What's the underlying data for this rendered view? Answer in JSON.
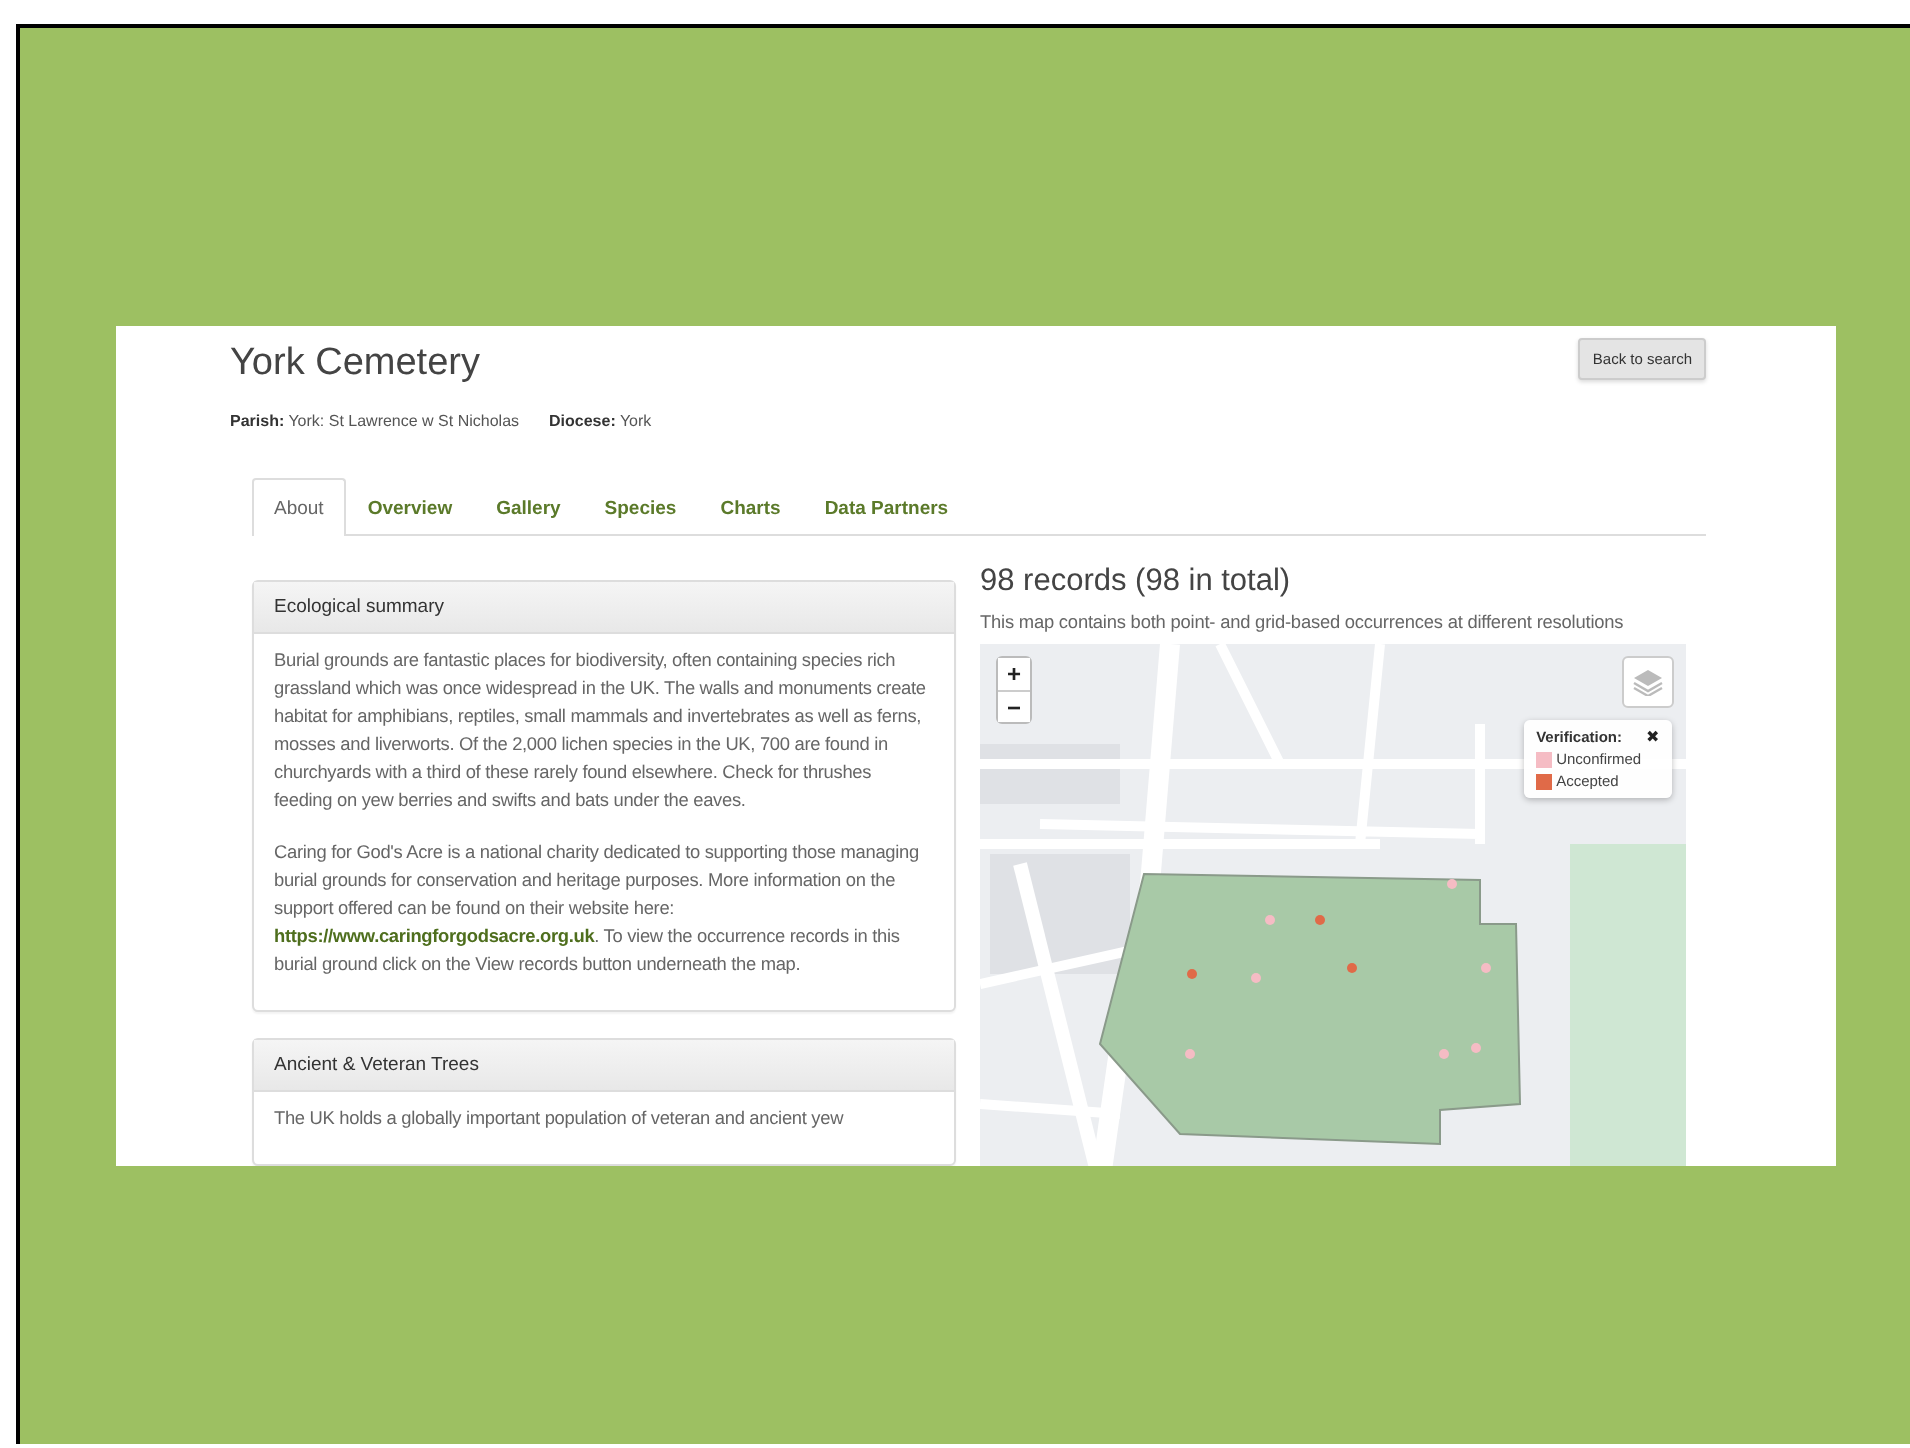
{
  "page": {
    "title": "York Cemetery",
    "back_button": "Back to search",
    "meta": [
      "**Parish:** York: St Lawrence w St Nicholas",
      "**Diocese:** York"
    ]
  },
  "tabs": [
    {
      "label": "About",
      "selected": true
    },
    {
      "label": "Overview",
      "selected": false
    },
    {
      "label": "Gallery",
      "selected": false
    },
    {
      "label": "Species",
      "selected": false
    },
    {
      "label": "Charts",
      "selected": false
    },
    {
      "label": "Data Partners",
      "selected": false
    }
  ],
  "panels": [
    {
      "title": "Ecological summary",
      "paragraphs": [
        {
          "text": "Burial grounds are fantastic places for biodiversity, often containing species rich grassland which was once widespread in the UK. The walls and monuments create habitat for amphibians, reptiles, small mammals and invertebrates as well as ferns, mosses and liverworts. Of the 2,000 lichen species in the UK, 700 are found in churchyards with a third of these rarely found elsewhere. Check for thrushes feeding on yew berries and swifts and bats under the eaves."
        },
        {
          "text": "Caring for God's Acre is a national charity dedicated to supporting those managing burial grounds for conservation and heritage purposes. More information on the support offered can be found on their website here:",
          "link": "https://www.caringforgodsacre.org.uk",
          "text_after": ". To view the occurrence records in this burial ground click on the View records button underneath the map."
        }
      ]
    },
    {
      "title": "Ancient & Veteran Trees",
      "paragraphs": [
        {
          "text": "The UK holds a globally important population of veteran and ancient yew"
        }
      ]
    }
  ],
  "map_section": {
    "heading": "98 records (98 in total)",
    "description": "This map contains both point- and grid-based occurrences at different resolutions",
    "map": {
      "kind": "picture",
      "zoom_in": "+",
      "zoom_out": "−",
      "legend": {
        "title": "Verification:",
        "close": "✖",
        "items": [
          {
            "label": "Unconfirmed",
            "color": "#f5bcc4"
          },
          {
            "label": "Accepted",
            "color": "#e06a48"
          }
        ]
      }
    }
  }
}
